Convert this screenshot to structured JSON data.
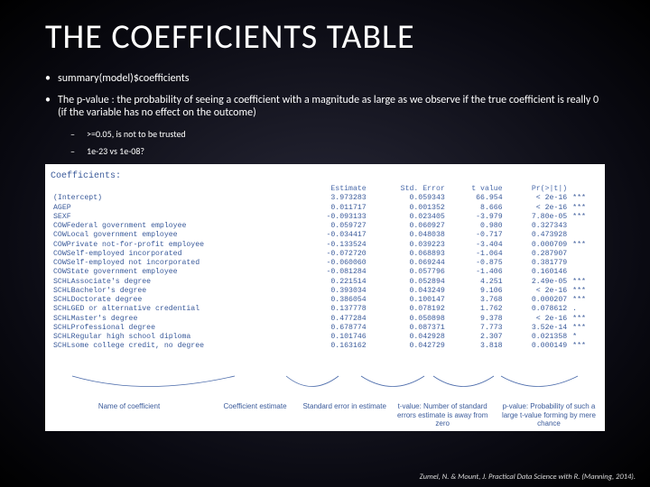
{
  "title": "THE COEFFICIENTS TABLE",
  "bullets": {
    "b1": "summary(model)$coefficients",
    "b2": "The p-value : the probability of seeing a coefficient with a magnitude as large as we observe if the true coefficient is really 0 (if the variable has no effect on the outcome)",
    "s1": ">=0.05, is not to be trusted",
    "s2": "1e-23 vs 1e-08?"
  },
  "coef_header": "Coefficients:",
  "chart_data": {
    "type": "table",
    "columns": [
      "",
      "Estimate",
      "Std. Error",
      "t value",
      "Pr(>|t|)",
      ""
    ],
    "rows": [
      [
        "(Intercept)",
        "3.973283",
        "0.059343",
        "66.954",
        "< 2e-16",
        "***"
      ],
      [
        "AGEP",
        "0.011717",
        "0.001352",
        "8.666",
        "< 2e-16",
        "***"
      ],
      [
        "SEXF",
        "-0.093133",
        "0.023405",
        "-3.979",
        "7.80e-05",
        "***"
      ],
      [
        "COWFederal government employee",
        "0.059727",
        "0.060927",
        "0.980",
        "0.327343",
        ""
      ],
      [
        "COWLocal government employee",
        "-0.034417",
        "0.048038",
        "-0.717",
        "0.473928",
        ""
      ],
      [
        "COWPrivate not-for-profit employee",
        "-0.133524",
        "0.039223",
        "-3.404",
        "0.000709",
        "***"
      ],
      [
        "COWSelf-employed incorporated",
        "-0.072720",
        "0.068893",
        "-1.064",
        "0.287907",
        ""
      ],
      [
        "COWSelf-employed not incorporated",
        "-0.060060",
        "0.069244",
        "-0.875",
        "0.381779",
        ""
      ],
      [
        "COWState government employee",
        "-0.081284",
        "0.057796",
        "-1.406",
        "0.160146",
        ""
      ],
      [
        "SCHLAssociate's degree",
        "0.221514",
        "0.052894",
        "4.251",
        "2.49e-05",
        "***"
      ],
      [
        "SCHLBachelor's degree",
        "0.393034",
        "0.043249",
        "9.106",
        "< 2e-16",
        "***"
      ],
      [
        "SCHLDoctorate degree",
        "0.386054",
        "0.100147",
        "3.768",
        "0.000207",
        "***"
      ],
      [
        "SCHLGED or alternative credential",
        "0.137778",
        "0.078192",
        "1.762",
        "0.078612",
        "."
      ],
      [
        "SCHLMaster's degree",
        "0.477284",
        "0.050898",
        "9.378",
        "< 2e-16",
        "***"
      ],
      [
        "SCHLProfessional degree",
        "0.678774",
        "0.087371",
        "7.773",
        "3.52e-14",
        "***"
      ],
      [
        "SCHLRegular high school diploma",
        "0.101746",
        "0.042928",
        "2.307",
        "0.021358",
        "*"
      ],
      [
        "SCHLsome college credit, no degree",
        "0.163162",
        "0.042729",
        "3.818",
        "0.000149",
        "***"
      ]
    ],
    "column_labels": [
      "Name of coefficient",
      "Coefficient estimate",
      "Standard error in estimate",
      "t-value: Number of standard errors estimate is away from zero",
      "p-value: Probability of such a large t-value forming by mere chance"
    ]
  },
  "citation": "Zumel, N. & Mount, J. Practical Data Science with R. (Manning, 2014)."
}
